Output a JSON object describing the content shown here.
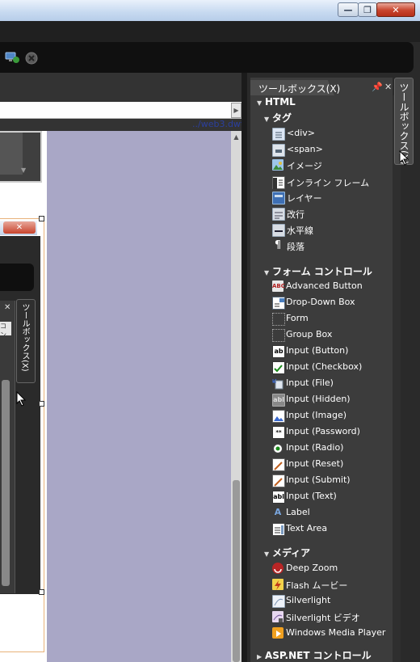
{
  "window": {
    "minimize_glyph": "—",
    "maximize_glyph": "❐",
    "close_glyph": "✕"
  },
  "editor": {
    "file_path": "../web3.dwt"
  },
  "embedded_screenshot": {
    "close_glyph": "✕",
    "toolbox_tab_text": "ツールボックス(X)",
    "panel_close_glyph": "✕",
    "list_text": "コン"
  },
  "toolbox": {
    "title": "ツールボックス(X)",
    "side_tab_label": "ツールボックス(X)",
    "root": "HTML",
    "categories": [
      {
        "label": "タグ",
        "items": [
          {
            "label": "<div>",
            "icon": "div-icon"
          },
          {
            "label": "<span>",
            "icon": "span-icon"
          },
          {
            "label": "イメージ",
            "icon": "image-icon"
          },
          {
            "label": "インライン フレーム",
            "icon": "inline-frame-icon"
          },
          {
            "label": "レイヤー",
            "icon": "layer-icon"
          },
          {
            "label": "改行",
            "icon": "line-break-icon"
          },
          {
            "label": "水平線",
            "icon": "horizontal-line-icon"
          },
          {
            "label": "段落",
            "icon": "paragraph-icon"
          }
        ]
      },
      {
        "label": "フォーム コントロール",
        "items": [
          {
            "label": "Advanced Button",
            "icon": "advanced-button-icon"
          },
          {
            "label": "Drop-Down Box",
            "icon": "dropdown-box-icon"
          },
          {
            "label": "Form",
            "icon": "form-icon"
          },
          {
            "label": "Group Box",
            "icon": "group-box-icon"
          },
          {
            "label": "Input (Button)",
            "icon": "input-button-icon"
          },
          {
            "label": "Input (Checkbox)",
            "icon": "input-checkbox-icon"
          },
          {
            "label": "Input (File)",
            "icon": "input-file-icon"
          },
          {
            "label": "Input (Hidden)",
            "icon": "input-hidden-icon"
          },
          {
            "label": "Input (Image)",
            "icon": "input-image-icon"
          },
          {
            "label": "Input (Password)",
            "icon": "input-password-icon"
          },
          {
            "label": "Input (Radio)",
            "icon": "input-radio-icon"
          },
          {
            "label": "Input (Reset)",
            "icon": "input-reset-icon"
          },
          {
            "label": "Input (Submit)",
            "icon": "input-submit-icon"
          },
          {
            "label": "Input (Text)",
            "icon": "input-text-icon"
          },
          {
            "label": "Label",
            "icon": "label-icon"
          },
          {
            "label": "Text Area",
            "icon": "text-area-icon"
          }
        ]
      },
      {
        "label": "メディア",
        "items": [
          {
            "label": "Deep Zoom",
            "icon": "deep-zoom-icon"
          },
          {
            "label": "Flash ムービー",
            "icon": "flash-movie-icon"
          },
          {
            "label": "Silverlight",
            "icon": "silverlight-icon"
          },
          {
            "label": "Silverlight ビデオ",
            "icon": "silverlight-video-icon"
          },
          {
            "label": "Windows Media Player",
            "icon": "windows-media-player-icon"
          }
        ]
      }
    ],
    "collapsed_category": "ASP.NET コントロール"
  },
  "colors": {
    "panel_bg": "#3c3c3c",
    "design_surface": "#a9a7c6",
    "path_link": "#2b3f9e"
  }
}
